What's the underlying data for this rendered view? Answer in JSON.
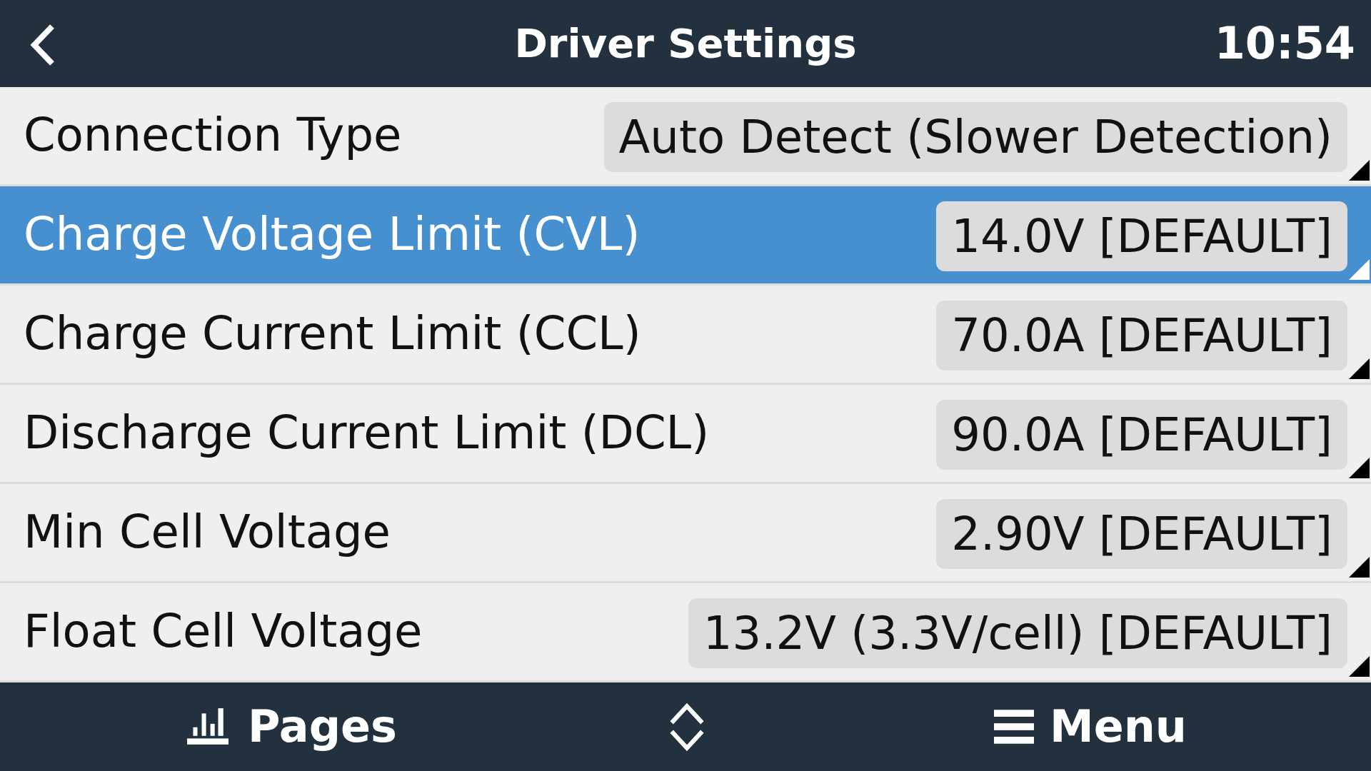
{
  "header": {
    "title": "Driver Settings",
    "time": "10:54"
  },
  "settings": [
    {
      "label": "Connection Type",
      "value": "Auto Detect (Slower Detection)",
      "selected": false
    },
    {
      "label": "Charge Voltage Limit (CVL)",
      "value": "14.0V [DEFAULT]",
      "selected": true
    },
    {
      "label": "Charge Current Limit (CCL)",
      "value": "70.0A [DEFAULT]",
      "selected": false
    },
    {
      "label": "Discharge Current Limit (DCL)",
      "value": "90.0A [DEFAULT]",
      "selected": false
    },
    {
      "label": "Min Cell Voltage",
      "value": "2.90V [DEFAULT]",
      "selected": false
    },
    {
      "label": "Float Cell Voltage",
      "value": "13.2V (3.3V/cell) [DEFAULT]",
      "selected": false
    }
  ],
  "bottom_bar": {
    "buttons": [
      {
        "kind": "pages",
        "label": "Pages"
      },
      {
        "kind": "toggle"
      },
      {
        "kind": "menu",
        "label": "Menu"
      }
    ]
  }
}
